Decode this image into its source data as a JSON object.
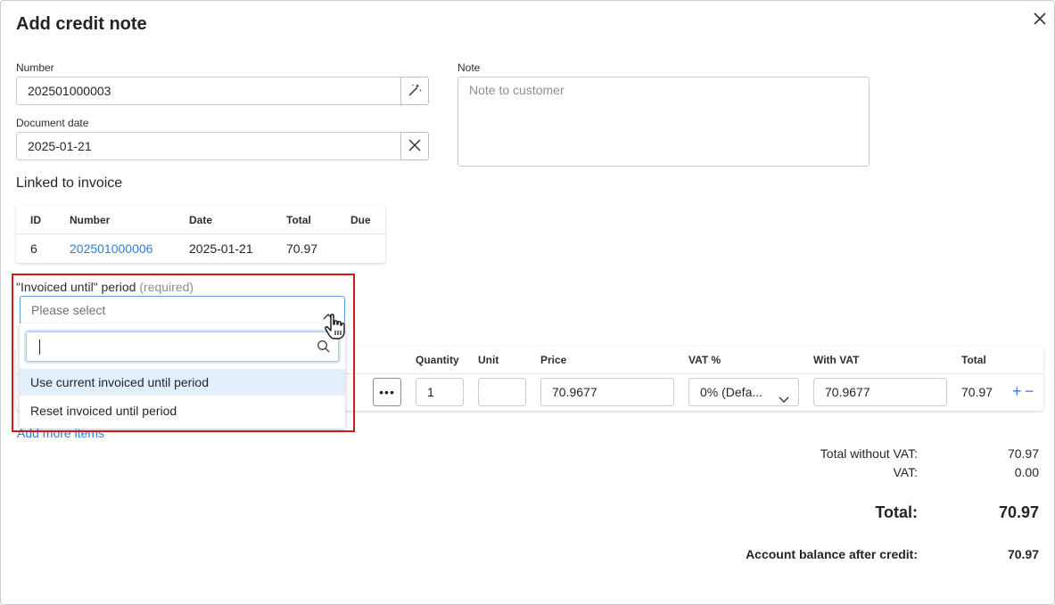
{
  "modal": {
    "title": "Add credit note"
  },
  "number": {
    "label": "Number",
    "value": "202501000003"
  },
  "document_date": {
    "label": "Document date",
    "value": "2025-01-21"
  },
  "note": {
    "label": "Note",
    "placeholder": "Note to customer"
  },
  "linked_invoice": {
    "heading": "Linked to invoice",
    "columns": [
      "ID",
      "Number",
      "Date",
      "Total",
      "Due"
    ],
    "rows": [
      {
        "id": "6",
        "number": "202501000006",
        "date": "2025-01-21",
        "total": "70.97",
        "due": ""
      }
    ]
  },
  "invoiced_until": {
    "label": "\"Invoiced until\" period",
    "required": "(required)",
    "placeholder": "Please select",
    "options": [
      "Use current invoiced until period",
      "Reset invoiced until period"
    ]
  },
  "items": {
    "columns": {
      "quantity": "Quantity",
      "unit": "Unit",
      "price": "Price",
      "vat": "VAT %",
      "with_vat": "With VAT",
      "total": "Total"
    },
    "row": {
      "quantity": "1",
      "unit": "",
      "price": "70.9677",
      "vat": "0% (Defa...",
      "with_vat": "70.9677",
      "total": "70.97"
    },
    "add_more": "Add more items"
  },
  "summary": {
    "total_without_vat_label": "Total without VAT:",
    "total_without_vat": "70.97",
    "vat_label": "VAT:",
    "vat": "0.00",
    "total_label": "Total:",
    "total": "70.97",
    "balance_label": "Account balance after credit:",
    "balance": "70.97"
  },
  "colors": {
    "accent": "#2f7fd6",
    "highlight": "#d0191f",
    "option_hover": "#e3eefb"
  }
}
